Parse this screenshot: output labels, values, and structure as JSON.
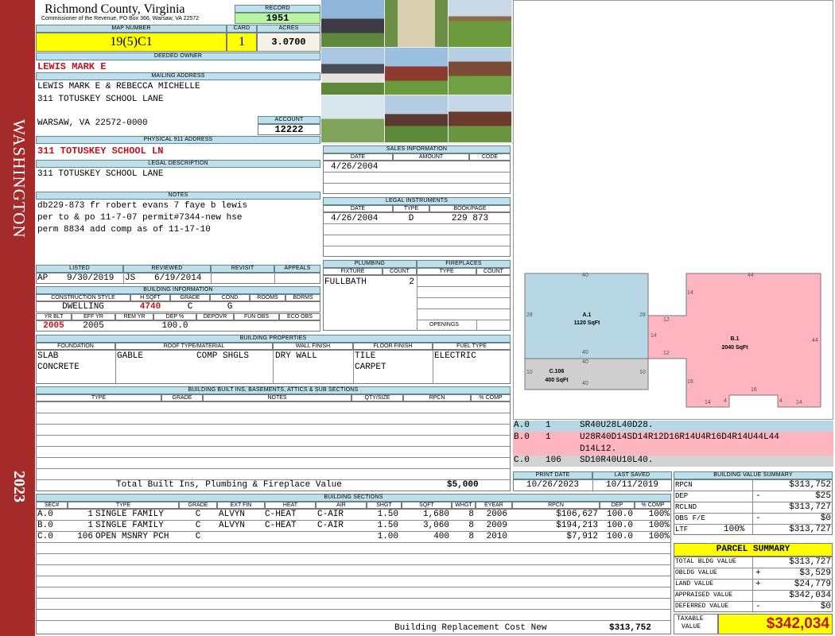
{
  "sidebar": {
    "district": "WASHINGTON",
    "year": "2023"
  },
  "header": {
    "county": "Richmond County, Virginia",
    "address_line": "Commissioner of the Revenue, PO Box 366, Warsaw, VA 22572"
  },
  "record": {
    "label": "RECORD",
    "value": "1951"
  },
  "map_number": {
    "label": "MAP NUMBER",
    "value": "19(5)C1"
  },
  "card": {
    "label": "CARD",
    "value": "1"
  },
  "acres": {
    "label": "ACRES",
    "value": "3.0700"
  },
  "deeded_owner": {
    "label": "DEEDED OWNER",
    "value": "LEWIS MARK E"
  },
  "mailing": {
    "label": "MAILING ADDRESS",
    "line1": "LEWIS MARK E & REBECCA MICHELLE",
    "line2": "311 TOTUSKEY SCHOOL LANE",
    "line3": "WARSAW, VA 22572-0000"
  },
  "account": {
    "label": "ACCOUNT",
    "value": "12222"
  },
  "physical": {
    "label": "PHYSICAL 911 ADDRESS",
    "value": "311 TOTUSKEY SCHOOL LN"
  },
  "legal": {
    "label": "LEGAL DESCRIPTION",
    "value": "311 TOTUSKEY SCHOOL LANE"
  },
  "notes": {
    "label": "NOTES",
    "line1": "db229-873 fr robert evans 7 faye b lewis",
    "line2": "per to & po 11-7-07 permit#7344-new hse",
    "line3": "perm 8834 add comp as of 11-17-10"
  },
  "status": {
    "listed_label": "LISTED",
    "reviewed_label": "REVIEWED",
    "revisit_label": "REVISIT",
    "appeals_label": "APPEALS",
    "listed_by": "AP",
    "listed_date": "9/30/2019",
    "reviewed_by": "JS",
    "reviewed_date": "6/19/2014"
  },
  "building_info": {
    "label": "BUILDING INFORMATION",
    "h_style": "CONSTRUCTION STYLE",
    "h_sqft": "H SQFT",
    "h_grade": "GRADE",
    "h_cond": "COND",
    "h_rooms": "ROOMS",
    "h_bdrms": "BDRMS",
    "style": "DWELLING",
    "sqft": "4740",
    "grade": "C",
    "cond": "G",
    "h_yrblt": "YR BLT",
    "h_effyr": "EFF YR",
    "h_remyr": "REM YR",
    "h_dep": "DEP %",
    "h_depovr": "DEPOVR",
    "h_funobs": "FUN OBS",
    "h_ecoobs": "ECO OBS",
    "yrblt": "2005",
    "effyr": "2005",
    "dep": "100.0"
  },
  "sales": {
    "label": "SALES INFORMATION",
    "h_date": "DATE",
    "h_amount": "AMOUNT",
    "h_code": "CODE",
    "date": "4/26/2004"
  },
  "instruments": {
    "label": "LEGAL INSTRUMENTS",
    "h_date": "DATE",
    "h_type": "TYPE",
    "h_book": "BOOK/PAGE",
    "date": "4/26/2004",
    "type": "D",
    "book": "229 873"
  },
  "plumbing": {
    "label": "PLUMBING",
    "h_fixture": "FIXTURE",
    "h_count": "COUNT",
    "fixture": "FULLBATH",
    "count": "2"
  },
  "fireplaces": {
    "label": "FIREPLACES",
    "h_type": "TYPE",
    "h_count": "COUNT",
    "openings": "OPENINGS"
  },
  "properties": {
    "label": "BUILDING PROPERTIES",
    "h_foundation": "FOUNDATION",
    "h_roof": "ROOF TYPE/MATERIAL",
    "h_wall": "WALL FINISH",
    "h_floor": "FLOOR FINISH",
    "h_fuel": "FUEL TYPE",
    "foundation1": "SLAB",
    "foundation2": "CONCRETE",
    "roof_type": "GABLE",
    "roof_material": "COMP SHGLS",
    "wall": "DRY WALL",
    "floor1": "TILE",
    "floor2": "CARPET",
    "fuel": "ELECTRIC"
  },
  "builtins": {
    "label": "BUILDING BUILT INS, BASEMENTS, ATTICS & SUB SECTIONS",
    "h_type": "TYPE",
    "h_grade": "GRADE",
    "h_notes": "NOTES",
    "h_qty": "QTY/SIZE",
    "h_rpcn": "RPCN",
    "h_comp": "% COMP",
    "total_label": "Total Built Ins, Plumbing & Fireplace Value",
    "total_value": "$5,000"
  },
  "dates": {
    "print_label": "PRINT DATE",
    "saved_label": "LAST SAVED",
    "print_date": "10/26/2023",
    "saved_date": "10/11/2019"
  },
  "sketch": {
    "a_label": "A.1",
    "a_area": "1120 SqFt",
    "b_label": "B.1",
    "b_area": "2040 SqFt",
    "c_label": "C.106",
    "c_area": "400 SqFt",
    "d40a": "40",
    "d40b": "40",
    "d40c": "40",
    "d40d": "40",
    "d28a": "28",
    "d28b": "28",
    "d44a": "44",
    "d44b": "44",
    "d14a": "14",
    "d14b": "14",
    "d14c": "14",
    "d14d": "14",
    "d12a": "12",
    "d12b": "12",
    "d16a": "16",
    "d16b": "16",
    "d4a": "4",
    "d4b": "4",
    "d10a": "10",
    "d10b": "10"
  },
  "sketch_codes": [
    {
      "sec": "A.0",
      "code": "1",
      "text": "SR40U28L40D28."
    },
    {
      "sec": "B.0",
      "code": "1",
      "text": "U28R40D14SD14R12D16R14U4R16D4R14U44L44",
      "text2": "D14L12."
    },
    {
      "sec": "C.0",
      "code": "106",
      "text": "SD10R40U10L40."
    }
  ],
  "value_summary": {
    "label": "BUILDING VALUE SUMMARY",
    "rpcn_label": "RPCN",
    "rpcn": "$313,752",
    "dep_label": "DEP",
    "dep_sign": "-",
    "dep": "$25",
    "rclnd_label": "RCLND",
    "rclnd": "$313,727",
    "obs_label": "OBS F/E",
    "obs_sign": "-",
    "obs": "$0",
    "ltf_label": "LTF",
    "ltf_pct": "100%",
    "ltf": "$313,727"
  },
  "parcel": {
    "label": "PARCEL SUMMARY",
    "bldg_label": "TOTAL BLDG VALUE",
    "bldg": "$313,727",
    "obldg_label": "OBLDG VALUE",
    "obldg_sign": "+",
    "obldg": "$3,529",
    "land_label": "LAND VALUE",
    "land_sign": "+",
    "land": "$24,779",
    "appraised_label": "APPRAISED VALUE",
    "appraised": "$342,034",
    "deferred_label": "DEFERRED VALUE",
    "deferred_sign": "-",
    "deferred": "$0",
    "taxable_label1": "TAXABLE",
    "taxable_label2": "VALUE",
    "taxable": "$342,034"
  },
  "sections": {
    "label": "BUILDING SECTIONS",
    "headers": [
      "SEC#",
      "TYPE",
      "GRADE",
      "EXT FIN",
      "HEAT",
      "AIR",
      "SHGT",
      "SQFT",
      "WHGT",
      "EYEAR",
      "RPCN",
      "DEP",
      "% COMP"
    ],
    "rows": [
      {
        "sec": "A.0",
        "code": "1",
        "type": "SINGLE FAMILY",
        "grade": "C",
        "ext": "ALVYN",
        "heat": "C-HEAT",
        "air": "C-AIR",
        "shgt": "1.50",
        "sqft": "1,680",
        "whgt": "8",
        "eyear": "2006",
        "rpcn": "$106,627",
        "dep": "100.0",
        "comp": "100%"
      },
      {
        "sec": "B.0",
        "code": "1",
        "type": "SINGLE FAMILY",
        "grade": "C",
        "ext": "ALVYN",
        "heat": "C-HEAT",
        "air": "C-AIR",
        "shgt": "1.50",
        "sqft": "3,060",
        "whgt": "8",
        "eyear": "2009",
        "rpcn": "$194,213",
        "dep": "100.0",
        "comp": "100%"
      },
      {
        "sec": "C.0",
        "code": "106",
        "type": "OPEN MSNRY PCH",
        "grade": "C",
        "ext": "",
        "heat": "",
        "air": "",
        "shgt": "1.00",
        "sqft": "400",
        "whgt": "8",
        "eyear": "2010",
        "rpcn": "$7,912",
        "dep": "100.0",
        "comp": "100%"
      }
    ],
    "replacement_label": "Building Replacement Cost New",
    "replacement_value": "$313,752"
  },
  "photos": [
    "house-front-photo",
    "shed-photo",
    "pergola-photo",
    "house-side-photo",
    "brick-house-photo",
    "playset-photo",
    "mailbox-photo",
    "house-rear-photo",
    "house-corner-photo"
  ]
}
